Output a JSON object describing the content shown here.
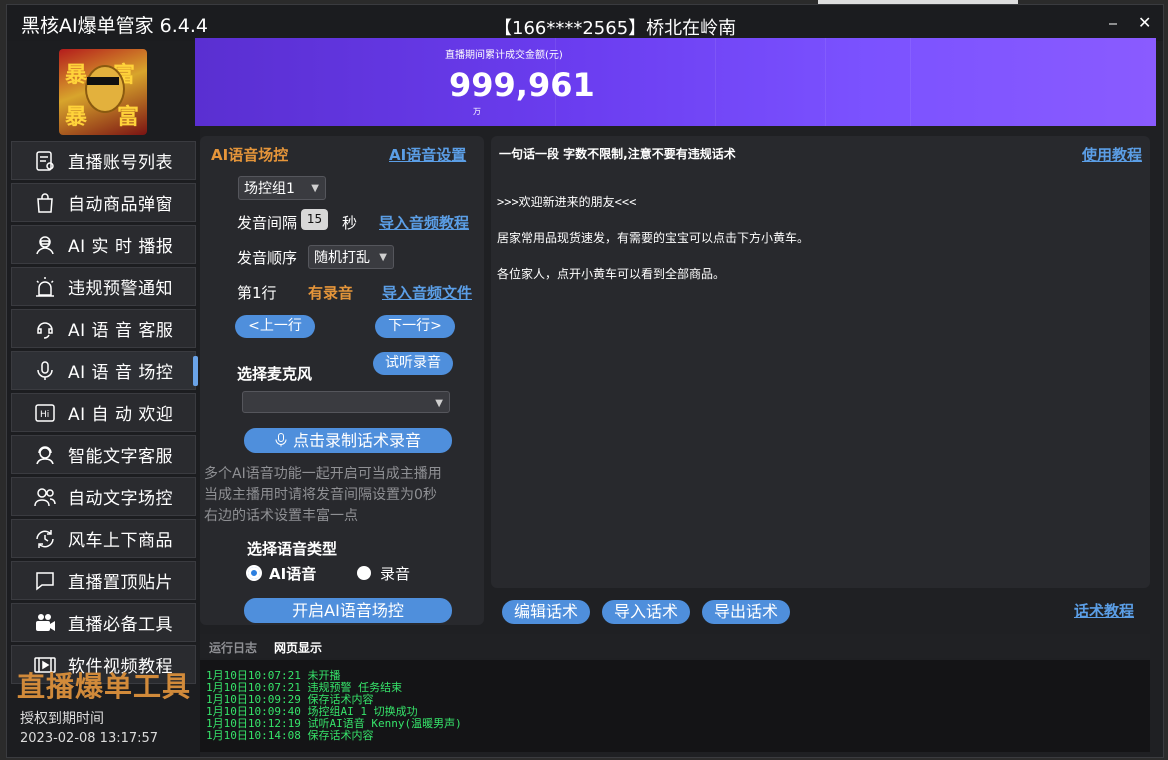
{
  "window": {
    "title": "黑核AI爆单管家 6.4.4",
    "account": "【166****2565】桥北在岭南",
    "minimize": "⎯",
    "close": "✕"
  },
  "logo": {
    "chars": [
      "暴",
      "富",
      "暴",
      "富"
    ]
  },
  "sidebar": {
    "items": [
      {
        "label": "直播账号列表",
        "icon": "account-list-icon"
      },
      {
        "label": "自动商品弹窗",
        "icon": "shopping-bag-icon"
      },
      {
        "label": "AI 实 时 播报",
        "icon": "ai-broadcast-icon"
      },
      {
        "label": "违规预警通知",
        "icon": "alarm-icon"
      },
      {
        "label": "AI 语 音 客服",
        "icon": "voice-service-icon"
      },
      {
        "label": "AI 语 音 场控",
        "icon": "microphone-icon"
      },
      {
        "label": "AI 自 动 欢迎",
        "icon": "hi-icon"
      },
      {
        "label": "智能文字客服",
        "icon": "headset-icon"
      },
      {
        "label": "自动文字场控",
        "icon": "users-icon"
      },
      {
        "label": "风车上下商品",
        "icon": "rotate-icon"
      },
      {
        "label": "直播置顶贴片",
        "icon": "pin-chat-icon"
      },
      {
        "label": "直播必备工具",
        "icon": "camera-icon"
      },
      {
        "label": "软件视频教程",
        "icon": "video-icon"
      }
    ],
    "active_index": 5,
    "brand": "直播爆单工具",
    "expire_label": "授权到期时间",
    "expire_value": "2023-02-08 13:17:57"
  },
  "banner": {
    "caption": "直播期间累计成交金额(元)",
    "amount": "999,961",
    "unit": "万"
  },
  "voice_control": {
    "title": "AI语音场控",
    "settings_link": "AI语音设置",
    "group_select": "场控组1",
    "interval_label": "发音间隔",
    "interval_value": "15",
    "interval_unit": "秒",
    "import_tutorial_link": "导入音频教程",
    "order_label": "发音顺序",
    "order_select": "随机打乱",
    "line_label": "第1行",
    "has_recording": "有录音",
    "import_file_link": "导入音频文件",
    "prev_button": "<上一行",
    "next_button": "下一行>",
    "mic_label": "选择麦克风",
    "listen_button": "试听录音",
    "mic_select": "",
    "record_button": "点击录制话术录音",
    "hint_lines": [
      "多个AI语音功能一起开启可当成主播用",
      "当成主播用时请将发音间隔设置为0秒",
      "右边的话术设置丰富一点"
    ],
    "voice_type_label": "选择语音类型",
    "voice_type_options": [
      "AI语音",
      "录音"
    ],
    "voice_type_selected": "AI语音",
    "start_button": "开启AI语音场控"
  },
  "script_panel": {
    "header": "一句话一段 字数不限制,注意不要有违规话术",
    "help_link": "使用教程",
    "lines": [
      ">>>欢迎新进来的朋友<<<",
      "居家常用品现货速发，有需要的宝宝可以点击下方小黄车。",
      "各位家人，点开小黄车可以看到全部商品。"
    ],
    "edit_button": "编辑话术",
    "import_button": "导入话术",
    "export_button": "导出话术",
    "tutorial_link": "话术教程"
  },
  "log": {
    "tabs": [
      "运行日志",
      "网页显示"
    ],
    "lines": [
      "1月10日10:07:21 未开播",
      "1月10日10:07:21 违规预警 任务结束",
      "1月10日10:09:29 保存话术内容",
      "1月10日10:09:40 场控组AI 1 切换成功",
      "1月10日10:12:19 试听AI语音 Kenny(温暖男声)",
      "1月10日10:14:08 保存话术内容"
    ]
  },
  "colors": {
    "accent": "#4f8fdc",
    "orange": "#e5953a",
    "log_green": "#36e36a",
    "banner": "#6b3df0"
  }
}
